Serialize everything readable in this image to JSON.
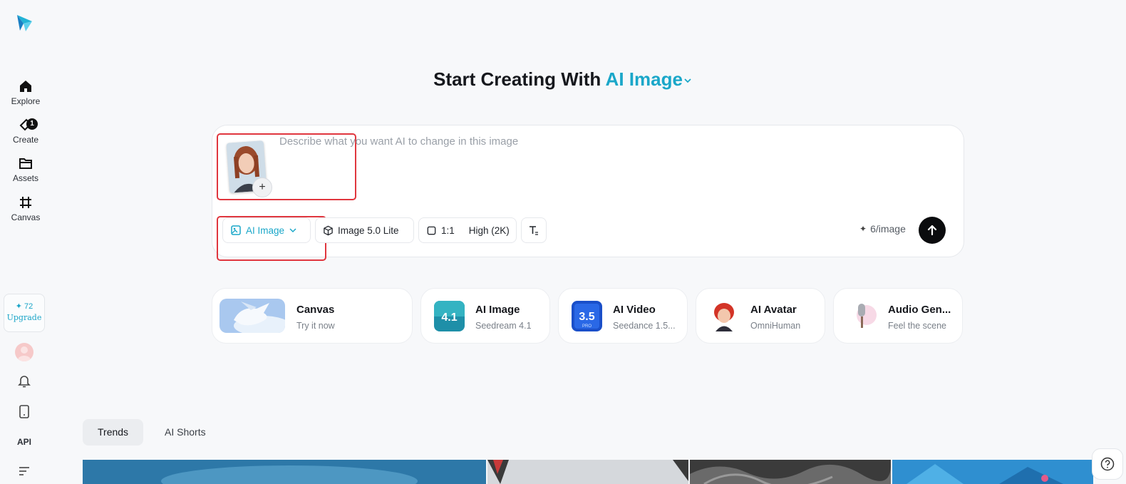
{
  "sidebar": {
    "nav": [
      {
        "id": "explore",
        "label": "Explore",
        "icon": "home-icon"
      },
      {
        "id": "create",
        "label": "Create",
        "icon": "create-icon",
        "badge": "1"
      },
      {
        "id": "assets",
        "label": "Assets",
        "icon": "folder-icon"
      },
      {
        "id": "canvas",
        "label": "Canvas",
        "icon": "canvas-icon"
      }
    ],
    "upgrade": {
      "credits": "✦ 72",
      "label": "Upgrade"
    },
    "api_label": "API"
  },
  "heading": {
    "prefix": "Start Creating With ",
    "mode": "AI Image"
  },
  "prompt": {
    "placeholder": "Describe what you want AI to change in this image",
    "value": "",
    "add_label": "+"
  },
  "toolbar": {
    "mode_label": "AI Image",
    "model_label": "Image 5.0 Lite",
    "ratio_label": "1:1",
    "quality_label": "High (2K)",
    "cost_label": "6/image"
  },
  "features": [
    {
      "title": "Canvas",
      "subtitle": "Try it now"
    },
    {
      "title": "AI Image",
      "subtitle": "Seedream 4.1"
    },
    {
      "title": "AI Video",
      "subtitle": "Seedance 1.5..."
    },
    {
      "title": "AI Avatar",
      "subtitle": "OmniHuman"
    },
    {
      "title": "Audio Gen...",
      "subtitle": "Feel the scene"
    }
  ],
  "feature_badges": {
    "image_version": "4.1",
    "video_version": "3.5",
    "video_tag": "PRO"
  },
  "tabs": [
    {
      "label": "Trends",
      "active": true
    },
    {
      "label": "AI Shorts",
      "active": false
    }
  ],
  "colors": {
    "accent": "#1aa7c9",
    "highlight": "#e0363e",
    "send": "#0b0c0e"
  }
}
